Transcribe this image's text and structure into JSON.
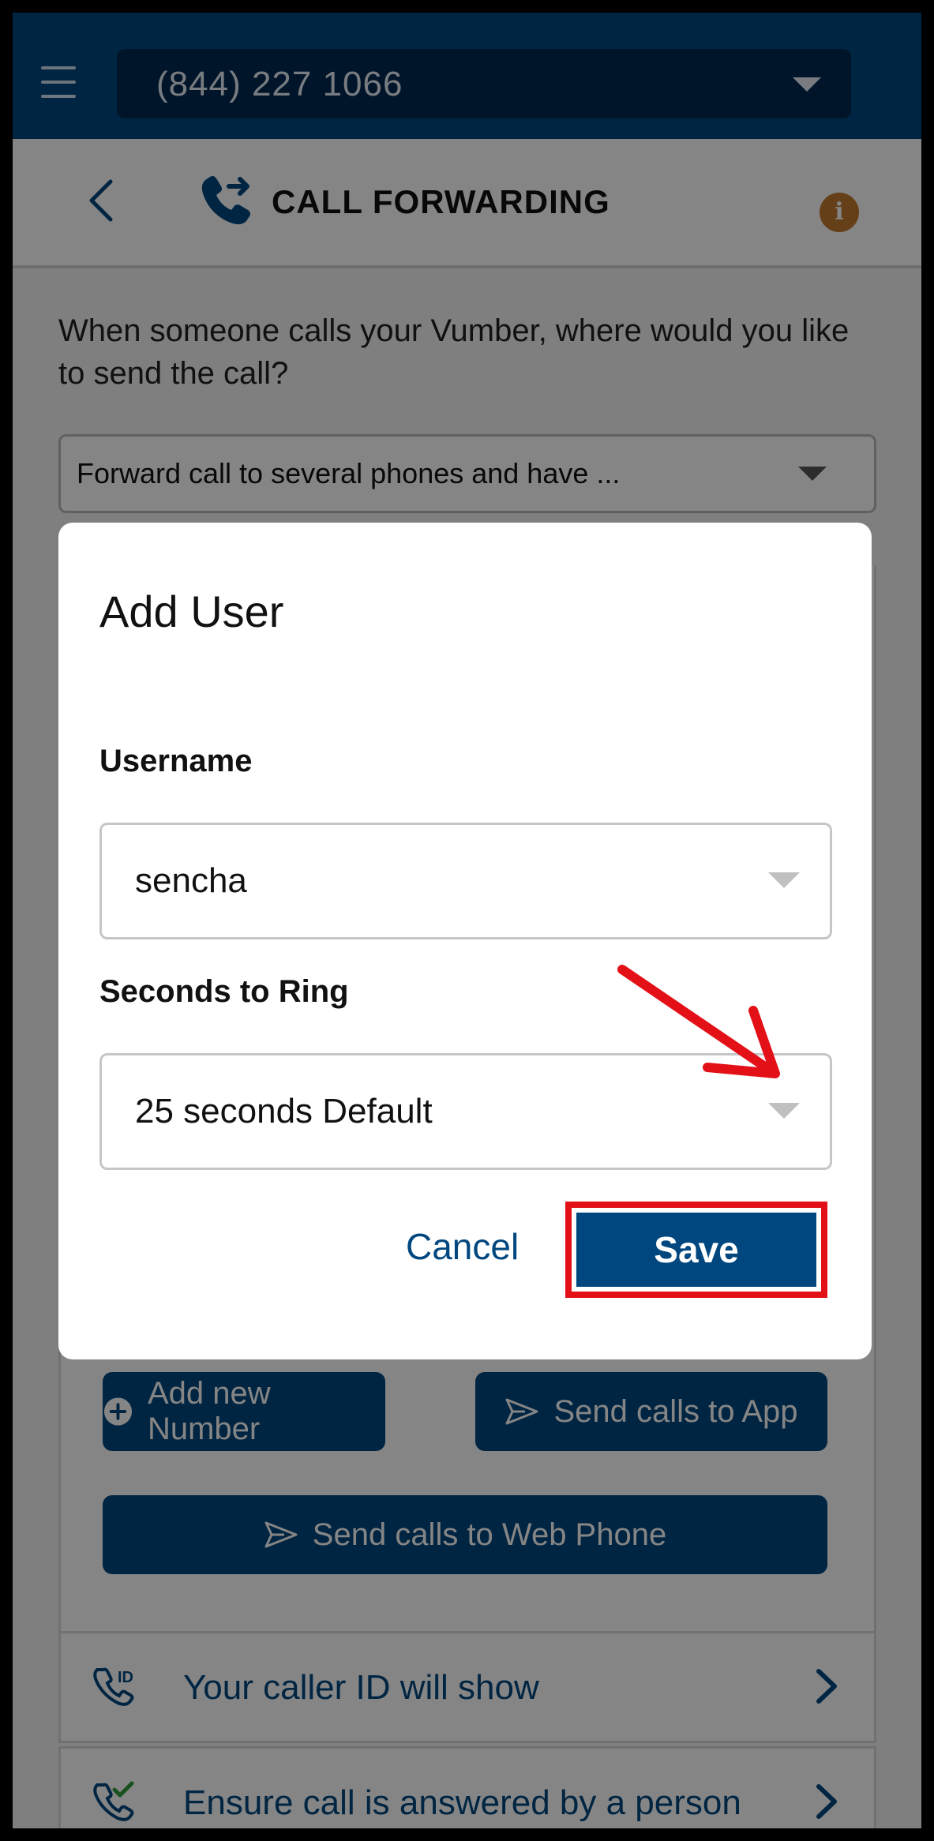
{
  "appbar": {
    "phone_number": "(844) 227 1066"
  },
  "header": {
    "title": "CALL FORWARDING"
  },
  "main": {
    "question": "When someone calls your Vumber, where would you like to send the call?",
    "forward_option": "Forward call to several phones and have ...",
    "buttons": {
      "add_number": "Add new Number",
      "send_app": "Send calls to App",
      "send_web": "Send calls to Web Phone"
    },
    "rows": {
      "caller_id": "Your caller ID will show",
      "ensure_answered": "Ensure call is answered by a person"
    }
  },
  "dialog": {
    "title": "Add User",
    "username_label": "Username",
    "username_value": "sencha",
    "seconds_label": "Seconds to Ring",
    "seconds_value": "25 seconds Default",
    "cancel_label": "Cancel",
    "save_label": "Save"
  },
  "colors": {
    "brand_blue": "#00477f",
    "highlight_red": "#e31017",
    "info_orange": "#c27a2c"
  },
  "icons": [
    "menu-icon",
    "chevron-down-icon",
    "back-icon",
    "call-forward-icon",
    "info-icon",
    "plus-circle-icon",
    "send-icon",
    "caller-id-icon",
    "phone-check-icon",
    "chevron-right-icon",
    "annotation-arrow"
  ]
}
